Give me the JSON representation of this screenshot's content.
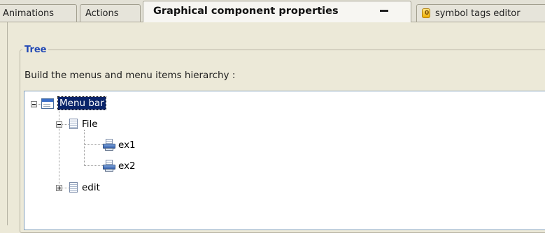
{
  "tabs": [
    {
      "label": "Animations",
      "active": false
    },
    {
      "label": "Actions",
      "active": false
    },
    {
      "label": "Graphical component properties",
      "active": true
    },
    {
      "label": "symbol tags editor",
      "active": false,
      "icon": "tag-icon",
      "icon_text": "0"
    }
  ],
  "group": {
    "title": "Tree",
    "instructions": "Build the menus and menu items hierarchy :"
  },
  "tree": {
    "root": {
      "label": "Menu bar",
      "selected": true,
      "expanded": true,
      "icon": "menu-bar-icon"
    },
    "menus": [
      {
        "label": "File",
        "expanded": true,
        "icon": "menu-icon",
        "items": [
          {
            "label": "ex1",
            "icon": "menu-item-icon"
          },
          {
            "label": "ex2",
            "icon": "menu-item-icon"
          }
        ]
      },
      {
        "label": "edit",
        "expanded": false,
        "icon": "menu-icon",
        "items": []
      }
    ]
  },
  "colors": {
    "selection": "#0A246A",
    "group_title": "#2148B5",
    "tree_border": "#7F9DB9"
  }
}
